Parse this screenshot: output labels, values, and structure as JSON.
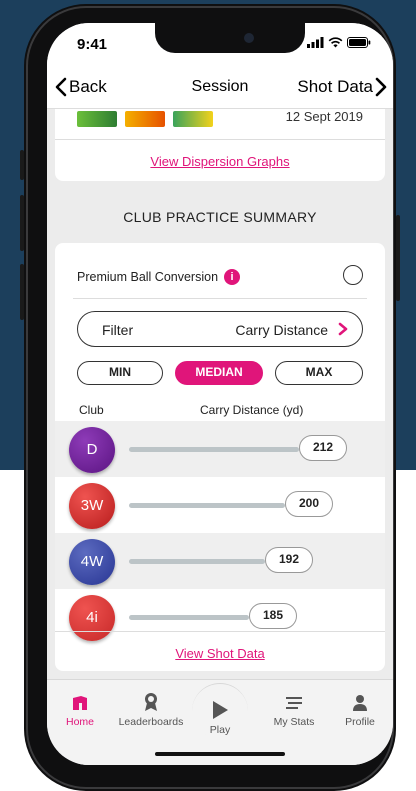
{
  "status_bar": {
    "time": "9:41"
  },
  "nav": {
    "back_label": "Back",
    "title": "Session",
    "right_label": "Shot Data"
  },
  "top_card": {
    "date": "12 Sept 2019",
    "link": "View Dispersion Graphs"
  },
  "section_title": "CLUB PRACTICE SUMMARY",
  "summary": {
    "premium_label": "Premium Ball Conversion",
    "premium_enabled": false,
    "filter_label": "Filter",
    "filter_value": "Carry Distance",
    "segments": [
      {
        "label": "MIN",
        "selected": false
      },
      {
        "label": "MEDIAN",
        "selected": true
      },
      {
        "label": "MAX",
        "selected": false
      }
    ],
    "col_club": "Club",
    "col_carry": "Carry Distance (yd)",
    "clubs": [
      {
        "club": "D",
        "distance": "212",
        "value": 212,
        "color": "#6a1b9a"
      },
      {
        "club": "3W",
        "distance": "200",
        "value": 200,
        "color": "#d32f2f"
      },
      {
        "club": "4W",
        "distance": "192",
        "value": 192,
        "color": "#3949ab"
      },
      {
        "club": "4i",
        "distance": "185",
        "value": 185,
        "color": "#e53935"
      }
    ],
    "link": "View Shot Data"
  },
  "tabs": [
    {
      "label": "Home",
      "icon": "home-icon",
      "active": true
    },
    {
      "label": "Leaderboards",
      "icon": "award-icon",
      "active": false
    },
    {
      "label": "Play",
      "icon": "play-icon",
      "active": false
    },
    {
      "label": "My Stats",
      "icon": "stats-icon",
      "active": false
    },
    {
      "label": "Profile",
      "icon": "profile-icon",
      "active": false
    }
  ],
  "colors": {
    "accent": "#e0157a",
    "background": "#1c3f5c"
  }
}
